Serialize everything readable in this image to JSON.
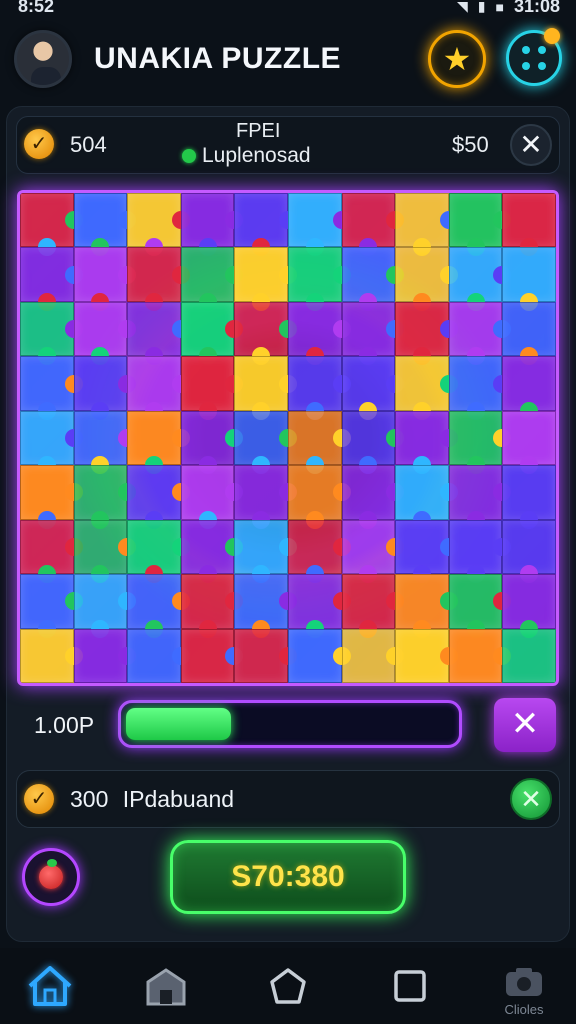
{
  "status_bar": {
    "time": "8:52",
    "right_time": "31:08"
  },
  "header": {
    "title": "UNAKIA PUZZLE"
  },
  "info_bar": {
    "left_score": "504",
    "mode_title": "FPEI",
    "mode_subtitle": "Luplenosad",
    "right_score": "$50"
  },
  "board": {
    "columns": 10,
    "rows": 9,
    "palette": [
      "#3f6bff",
      "#8a2be2",
      "#22c55e",
      "#ff8a1f",
      "#e0263f",
      "#2fb6ff",
      "#b03cf0",
      "#ffd12a",
      "#14d37a",
      "#5a3df5"
    ]
  },
  "progress": {
    "label": "1.00P",
    "fraction": 0.32
  },
  "reward": {
    "amount": "300",
    "label": "IPdabuand"
  },
  "buy_button": {
    "label": "S70:380"
  },
  "bottom_nav": {
    "items": [
      {
        "name": "home",
        "label": ""
      },
      {
        "name": "shop",
        "label": ""
      },
      {
        "name": "circle",
        "label": ""
      },
      {
        "name": "square",
        "label": ""
      },
      {
        "name": "camera",
        "label": "Clioles"
      }
    ]
  },
  "colors": {
    "accent_purple": "#b447ff",
    "accent_green": "#48ff6a",
    "accent_cyan": "#27d3e6",
    "accent_gold": "#f2a400"
  }
}
